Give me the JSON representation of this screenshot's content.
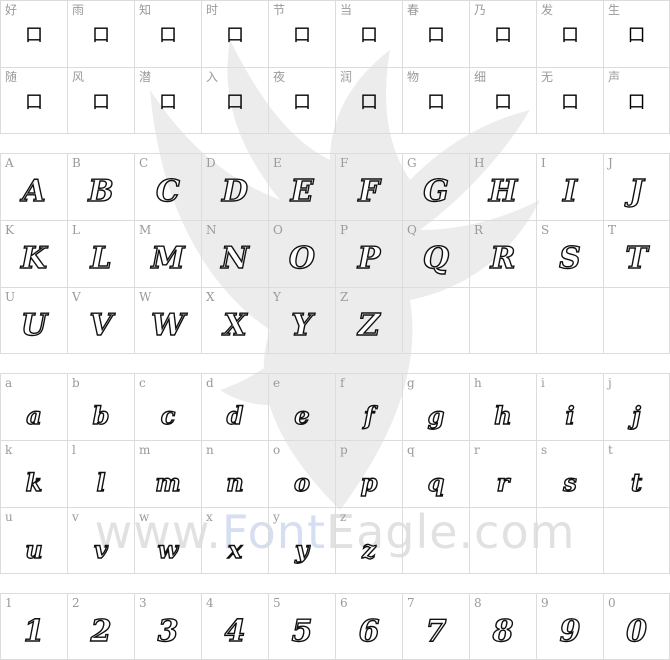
{
  "cjk_row1": [
    {
      "label": "好",
      "glyph": "口"
    },
    {
      "label": "雨",
      "glyph": "口"
    },
    {
      "label": "知",
      "glyph": "口"
    },
    {
      "label": "时",
      "glyph": "口"
    },
    {
      "label": "节",
      "glyph": "口"
    },
    {
      "label": "当",
      "glyph": "口"
    },
    {
      "label": "春",
      "glyph": "口"
    },
    {
      "label": "乃",
      "glyph": "口"
    },
    {
      "label": "发",
      "glyph": "口"
    },
    {
      "label": "生",
      "glyph": "口"
    }
  ],
  "cjk_row2": [
    {
      "label": "随",
      "glyph": "口"
    },
    {
      "label": "风",
      "glyph": "口"
    },
    {
      "label": "潜",
      "glyph": "口"
    },
    {
      "label": "入",
      "glyph": "口"
    },
    {
      "label": "夜",
      "glyph": "口"
    },
    {
      "label": "润",
      "glyph": "口"
    },
    {
      "label": "物",
      "glyph": "口"
    },
    {
      "label": "细",
      "glyph": "口"
    },
    {
      "label": "无",
      "glyph": "口"
    },
    {
      "label": "声",
      "glyph": "口"
    }
  ],
  "upper_rows": [
    [
      "A",
      "B",
      "C",
      "D",
      "E",
      "F",
      "G",
      "H",
      "I",
      "J"
    ],
    [
      "K",
      "L",
      "M",
      "N",
      "O",
      "P",
      "Q",
      "R",
      "S",
      "T"
    ],
    [
      "U",
      "V",
      "W",
      "X",
      "Y",
      "Z",
      "",
      "",
      "",
      ""
    ]
  ],
  "lower_rows": [
    [
      "a",
      "b",
      "c",
      "d",
      "e",
      "f",
      "g",
      "h",
      "i",
      "j"
    ],
    [
      "k",
      "l",
      "m",
      "n",
      "o",
      "p",
      "q",
      "r",
      "s",
      "t"
    ],
    [
      "u",
      "v",
      "w",
      "x",
      "y",
      "z",
      "",
      "",
      "",
      ""
    ]
  ],
  "digits": [
    "1",
    "2",
    "3",
    "4",
    "5",
    "6",
    "7",
    "8",
    "9",
    "0"
  ],
  "watermark": {
    "part1": "www.",
    "part2": "Font",
    "part3": "Eagle",
    "part4": ".com"
  }
}
